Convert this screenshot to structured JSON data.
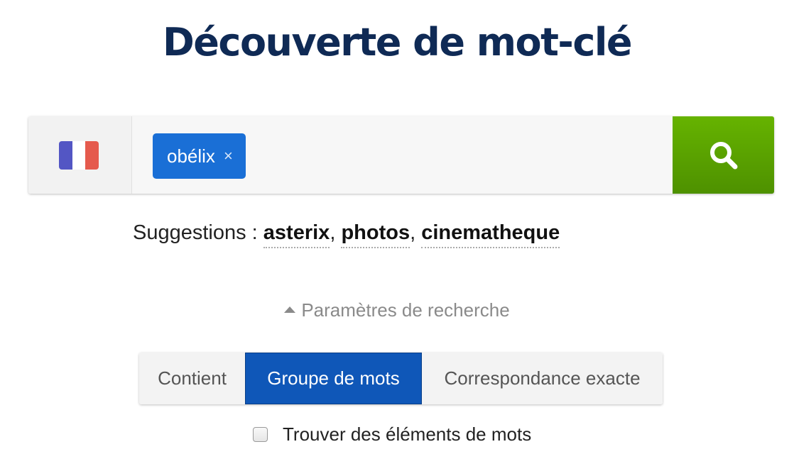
{
  "page_title": "Découverte de mot-clé",
  "search": {
    "country_flag": "france-flag-icon",
    "flag_colors": [
      "#5356c4",
      "#ffffff",
      "#e55a4d"
    ],
    "keyword_chip": "obélix",
    "chip_remove": "×",
    "button_icon": "search-icon",
    "button_color": "#5ea700"
  },
  "suggestions": {
    "label": "Suggestions :",
    "items": [
      "asterix",
      "photos",
      "cinematheque"
    ],
    "separator": ","
  },
  "search_params": {
    "toggle_label": "Paramètres de recherche",
    "match_options": [
      {
        "label": "Contient",
        "selected": false
      },
      {
        "label": "Groupe de mots",
        "selected": true
      },
      {
        "label": "Correspondance exacte",
        "selected": false
      }
    ],
    "accent_color": "#0f57b8",
    "word_elements_checkbox": {
      "label": "Trouver des éléments de mots",
      "checked": false
    }
  }
}
